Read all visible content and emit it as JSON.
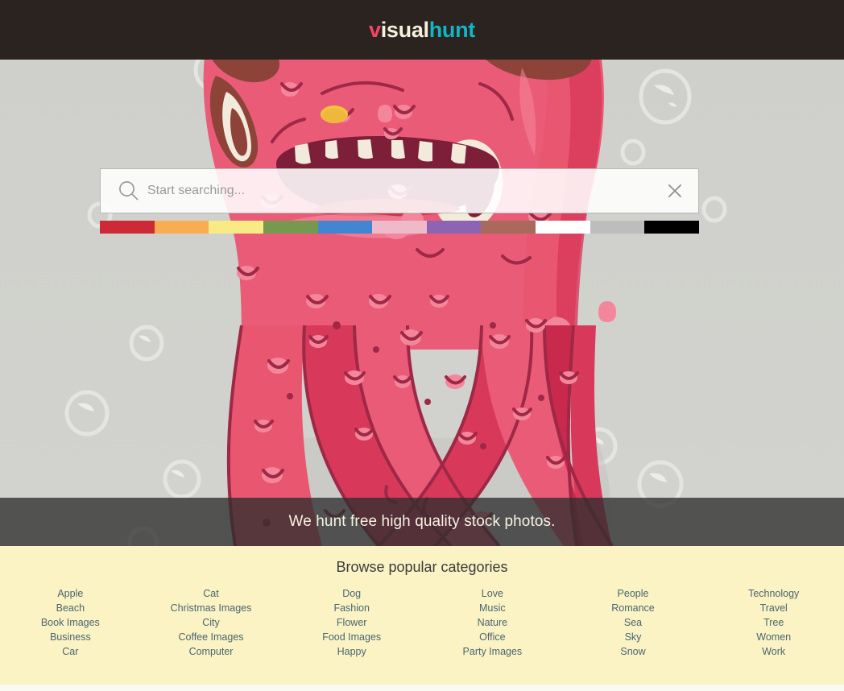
{
  "header": {
    "logo_part1": "v",
    "logo_part2": "isual",
    "logo_part3": "hunt",
    "logo_full": "visualhunt",
    "background_color": "#2b2320",
    "color_v": "#f9455f",
    "color_isual": "#f6f0dc",
    "color_hunt": "#11b6c4"
  },
  "hero": {
    "background_color": "#d0d1cc",
    "artwork_description": "pink blob monster with tentacles",
    "search": {
      "placeholder": "Start searching...",
      "value": "",
      "search_icon": "search-icon",
      "clear_icon": "close-icon"
    },
    "color_filters": [
      {
        "name": "red",
        "hex": "#cd2936"
      },
      {
        "name": "orange",
        "hex": "#f8ad50"
      },
      {
        "name": "yellow",
        "hex": "#f8ea84"
      },
      {
        "name": "green",
        "hex": "#74994f"
      },
      {
        "name": "blue",
        "hex": "#4286d2"
      },
      {
        "name": "pink",
        "hex": "#eeb9c9"
      },
      {
        "name": "purple",
        "hex": "#8d64b4"
      },
      {
        "name": "brown",
        "hex": "#a96a5b"
      },
      {
        "name": "white",
        "hex": "#ffffff"
      },
      {
        "name": "gray",
        "hex": "#bdbdbd"
      },
      {
        "name": "black",
        "hex": "#000000"
      }
    ],
    "tagline": "We hunt free high quality stock photos.",
    "tagline_background": "rgba(46,46,46,0.78)",
    "tagline_text_color": "#f7f2e2"
  },
  "categories": {
    "title": "Browse popular categories",
    "background_color": "#fbf3c3",
    "link_color": "#4a6572",
    "columns": [
      {
        "items": [
          "Apple",
          "Beach",
          "Book Images",
          "Business",
          "Car"
        ]
      },
      {
        "items": [
          "Cat",
          "Christmas Images",
          "City",
          "Coffee Images",
          "Computer"
        ]
      },
      {
        "items": [
          "Dog",
          "Fashion",
          "Flower",
          "Food Images",
          "Happy"
        ]
      },
      {
        "items": [
          "Love",
          "Music",
          "Nature",
          "Office",
          "Party Images"
        ]
      },
      {
        "items": [
          "People",
          "Romance",
          "Sea",
          "Sky",
          "Snow"
        ]
      },
      {
        "items": [
          "Technology",
          "Travel",
          "Tree",
          "Women",
          "Work"
        ]
      }
    ]
  }
}
